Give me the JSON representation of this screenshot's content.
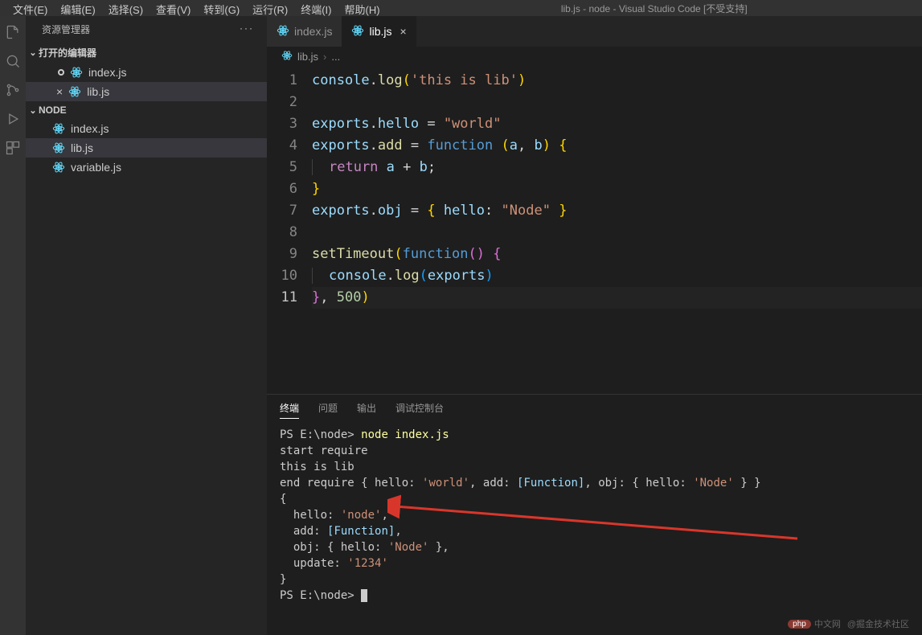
{
  "window_title": "lib.js - node - Visual Studio Code [不受支持]",
  "menu": [
    "文件(E)",
    "编辑(E)",
    "选择(S)",
    "查看(V)",
    "转到(G)",
    "运行(R)",
    "终端(I)",
    "帮助(H)"
  ],
  "sidebar": {
    "title": "资源管理器",
    "open_editors_label": "打开的编辑器",
    "open_editors": [
      {
        "name": "index.js",
        "icon": "react",
        "modified": false
      },
      {
        "name": "lib.js",
        "icon": "react",
        "modified": false,
        "active": true
      }
    ],
    "root": "NODE",
    "files": [
      {
        "name": "index.js",
        "icon": "react"
      },
      {
        "name": "lib.js",
        "icon": "react",
        "active": true
      },
      {
        "name": "variable.js",
        "icon": "react"
      }
    ]
  },
  "tabs": [
    {
      "name": "index.js",
      "icon": "react",
      "active": false
    },
    {
      "name": "lib.js",
      "icon": "react",
      "active": true
    }
  ],
  "breadcrumb": {
    "file": "lib.js"
  },
  "code": {
    "lines": [
      {
        "n": 1,
        "tokens": [
          [
            "prop",
            "console"
          ],
          [
            "punct",
            "."
          ],
          [
            "fn",
            "log"
          ],
          [
            "brace",
            "("
          ],
          [
            "str",
            "'this is lib'"
          ],
          [
            "brace",
            ")"
          ]
        ]
      },
      {
        "n": 2,
        "tokens": []
      },
      {
        "n": 3,
        "tokens": [
          [
            "prop",
            "exports"
          ],
          [
            "punct",
            "."
          ],
          [
            "prop",
            "hello"
          ],
          [
            "punct",
            " = "
          ],
          [
            "str",
            "\"world\""
          ]
        ]
      },
      {
        "n": 4,
        "tokens": [
          [
            "prop",
            "exports"
          ],
          [
            "punct",
            "."
          ],
          [
            "fn",
            "add"
          ],
          [
            "punct",
            " = "
          ],
          [
            "fnword",
            "function"
          ],
          [
            "punct",
            " "
          ],
          [
            "brace",
            "("
          ],
          [
            "prop",
            "a"
          ],
          [
            "punct",
            ", "
          ],
          [
            "prop",
            "b"
          ],
          [
            "brace",
            ")"
          ],
          [
            "punct",
            " "
          ],
          [
            "brace",
            "{"
          ]
        ]
      },
      {
        "n": 5,
        "indent": true,
        "tokens": [
          [
            "kw",
            "return"
          ],
          [
            "punct",
            " "
          ],
          [
            "prop",
            "a"
          ],
          [
            "punct",
            " + "
          ],
          [
            "prop",
            "b"
          ],
          [
            "punct",
            ";"
          ]
        ]
      },
      {
        "n": 6,
        "tokens": [
          [
            "brace",
            "}"
          ]
        ]
      },
      {
        "n": 7,
        "tokens": [
          [
            "prop",
            "exports"
          ],
          [
            "punct",
            "."
          ],
          [
            "prop",
            "obj"
          ],
          [
            "punct",
            " = "
          ],
          [
            "brace",
            "{"
          ],
          [
            "punct",
            " "
          ],
          [
            "prop",
            "hello"
          ],
          [
            "punct",
            ": "
          ],
          [
            "str",
            "\"Node\""
          ],
          [
            "punct",
            " "
          ],
          [
            "brace",
            "}"
          ]
        ]
      },
      {
        "n": 8,
        "tokens": []
      },
      {
        "n": 9,
        "tokens": [
          [
            "fn",
            "setTimeout"
          ],
          [
            "brace",
            "("
          ],
          [
            "fnword",
            "function"
          ],
          [
            "brace-p",
            "("
          ],
          [
            "brace-p",
            ")"
          ],
          [
            "punct",
            " "
          ],
          [
            "brace-p",
            "{"
          ]
        ]
      },
      {
        "n": 10,
        "indent": true,
        "tokens": [
          [
            "prop",
            "console"
          ],
          [
            "punct",
            "."
          ],
          [
            "fn",
            "log"
          ],
          [
            "brace-b",
            "("
          ],
          [
            "prop",
            "exports"
          ],
          [
            "brace-b",
            ")"
          ]
        ]
      },
      {
        "n": 11,
        "current": true,
        "tokens": [
          [
            "brace-p",
            "}"
          ],
          [
            "punct",
            ", "
          ],
          [
            "num",
            "500"
          ],
          [
            "brace",
            ")"
          ]
        ]
      }
    ]
  },
  "panel": {
    "tabs": [
      "终端",
      "问题",
      "输出",
      "调试控制台"
    ],
    "active_tab": 0,
    "terminal_prompt1": "PS E:\\node> ",
    "terminal_cmd": "node index.js",
    "terminal_lines": [
      "start require",
      "this is lib"
    ],
    "end_require_prefix": "end require { hello: ",
    "world": "'world'",
    "add_label": ", add: ",
    "function_label": "[Function]",
    "obj_label": ", obj: { hello: ",
    "node_q": "'Node'",
    "tail1": " } }",
    "obj_open": "{",
    "hello_line": "  hello: ",
    "node_val": "'node'",
    "comma": ",",
    "add_line": "  add: ",
    "obj_line_prefix": "  obj: { hello: ",
    "obj_line_suffix": " },",
    "update_line": "  update: ",
    "update_val": "'1234'",
    "obj_close": "}",
    "terminal_prompt2": "PS E:\\node> "
  },
  "watermark": {
    "label": "中文网",
    "source": "@掘金技术社区"
  }
}
